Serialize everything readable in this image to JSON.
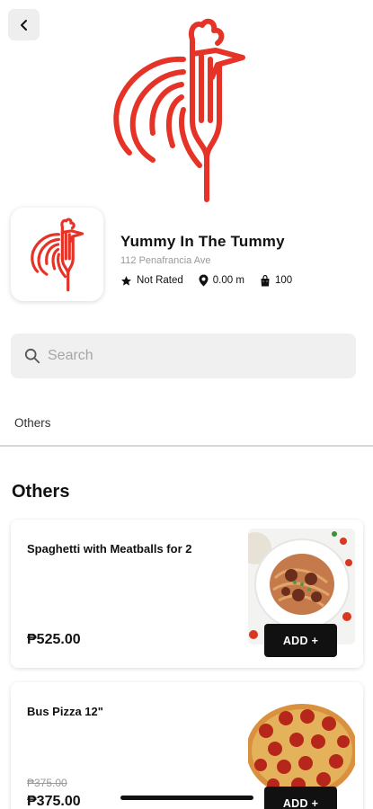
{
  "store": {
    "name": "Yummy In The Tummy",
    "address": "112 Penafrancia Ave",
    "rating": "Not Rated",
    "distance": "0.00 m",
    "bag_count": "100"
  },
  "colors": {
    "brand": "#e63327",
    "button": "#111111"
  },
  "search": {
    "placeholder": "Search"
  },
  "categories": [
    {
      "label": "Others"
    }
  ],
  "section": {
    "title": "Others"
  },
  "products": [
    {
      "name": "Spaghetti with Meatballs for 2",
      "price": "₱525.00",
      "add_label": "ADD +"
    },
    {
      "name": "Bus Pizza 12\"",
      "old_price": "₱375.00",
      "price": "₱375.00",
      "add_label": "ADD +"
    }
  ]
}
